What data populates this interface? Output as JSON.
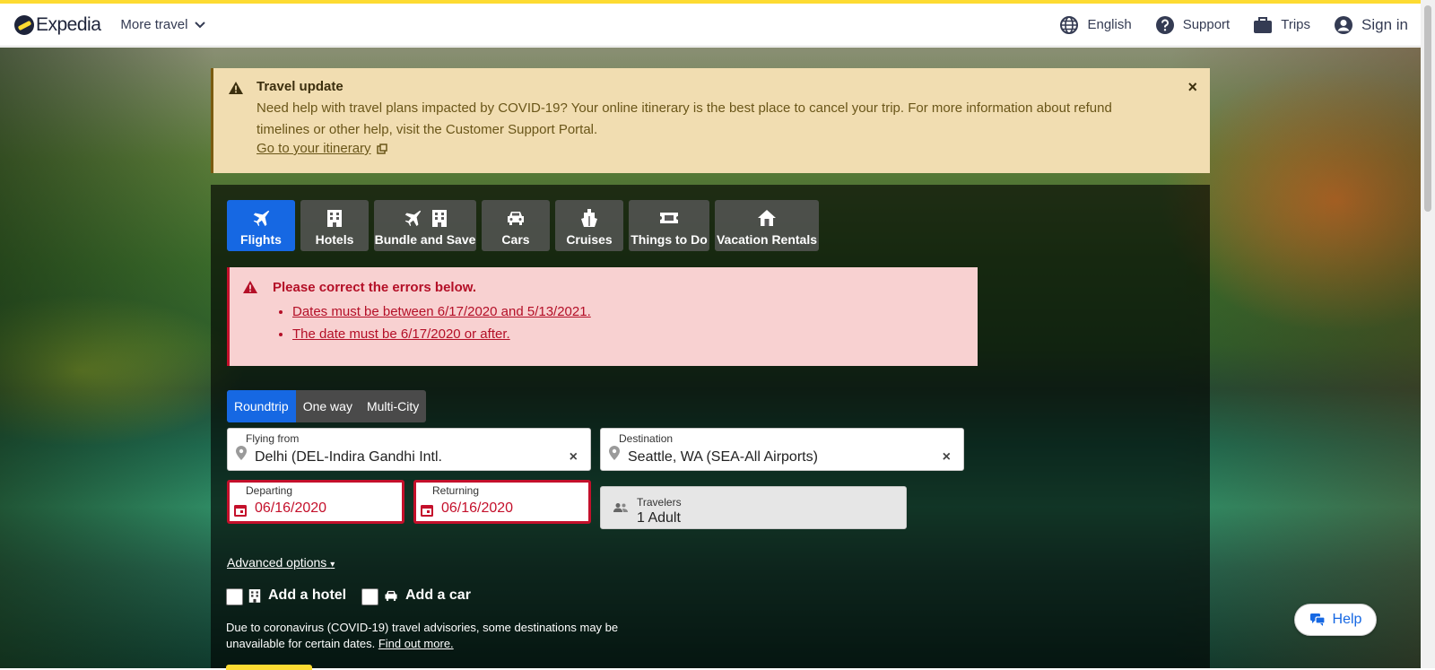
{
  "header": {
    "logo_text": "Expedia",
    "more_travel": "More travel",
    "language": "English",
    "support": "Support",
    "trips": "Trips",
    "sign_in": "Sign in"
  },
  "travel_update": {
    "title": "Travel update",
    "body": "Need help with travel plans impacted by COVID-19? Your online itinerary is the best place to cancel your trip. For more information about refund timelines or other help, visit the Customer Support Portal.",
    "link": "Go to your itinerary",
    "close": "×"
  },
  "tabs": [
    {
      "label": "Flights",
      "active": true
    },
    {
      "label": "Hotels"
    },
    {
      "label": "Bundle and Save"
    },
    {
      "label": "Cars"
    },
    {
      "label": "Cruises"
    },
    {
      "label": "Things to Do"
    },
    {
      "label": "Vacation Rentals"
    }
  ],
  "errors": {
    "title": "Please correct the errors below.",
    "items": [
      "Dates must be between 6/17/2020 and 5/13/2021.",
      "The date must be 6/17/2020 or after."
    ]
  },
  "trip_type": {
    "options": [
      "Roundtrip",
      "One way",
      "Multi-City"
    ],
    "selected": "Roundtrip"
  },
  "form": {
    "flying_from": {
      "label": "Flying from",
      "value": "Delhi (DEL-Indira Gandhi Intl."
    },
    "destination": {
      "label": "Destination",
      "value": "Seattle, WA (SEA-All Airports)"
    },
    "departing": {
      "label": "Departing",
      "value": "06/16/2020"
    },
    "returning": {
      "label": "Returning",
      "value": "06/16/2020"
    },
    "travelers": {
      "label": "Travelers",
      "value": "1 Adult"
    },
    "clear": "×"
  },
  "advanced_options": "Advanced options",
  "add_hotel": "Add a hotel",
  "add_car": "Add a car",
  "covid_note": {
    "text": "Due to coronavirus (COVID-19) travel advisories, some destinations may be unavailable for certain dates.",
    "link": "Find out more."
  },
  "help": "Help",
  "colors": {
    "accent": "#1668e3",
    "brand_yellow": "#fddb32",
    "error": "#c4102b",
    "banner_bg": "#f1ddb1"
  }
}
